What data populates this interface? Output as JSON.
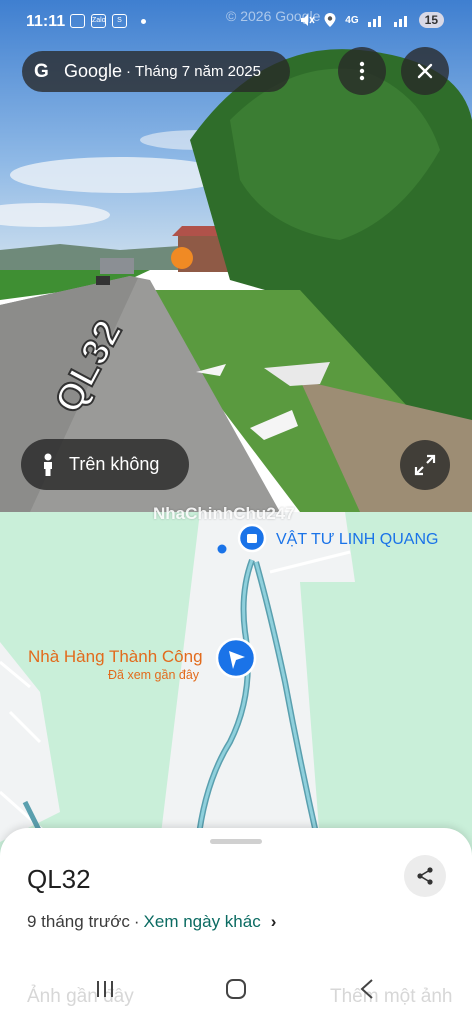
{
  "status": {
    "time": "11:11",
    "battery": "15",
    "network": "4G",
    "copyright": "© 2026 Google",
    "app_icons": [
      "gallery-icon",
      "zalo-icon",
      "shop-icon"
    ]
  },
  "header": {
    "brand": "Google",
    "dot": "·",
    "date": "Tháng 7 năm 2025"
  },
  "street": {
    "road_label": "QL32",
    "aerial_button": "Trên không"
  },
  "map": {
    "watermark": "NhaChinhChu247",
    "poi_store": "VẬT TƯ LINH QUANG",
    "poi_restaurant": "Nhà Hàng Thành Công",
    "poi_restaurant_sub": "Đã xem gần đây"
  },
  "sheet": {
    "title": "QL32",
    "time_ago": "9 tháng trước",
    "separator": "·",
    "other_days_link": "Xem ngày khác",
    "photos_label": "Ảnh gần đây",
    "add_photo_label": "Thêm một ảnh"
  },
  "colors": {
    "map_green": "#c9efd9",
    "link_teal": "#0b6b62",
    "poi_blue": "#1a73e8",
    "poi_orange": "#e26b1d"
  }
}
